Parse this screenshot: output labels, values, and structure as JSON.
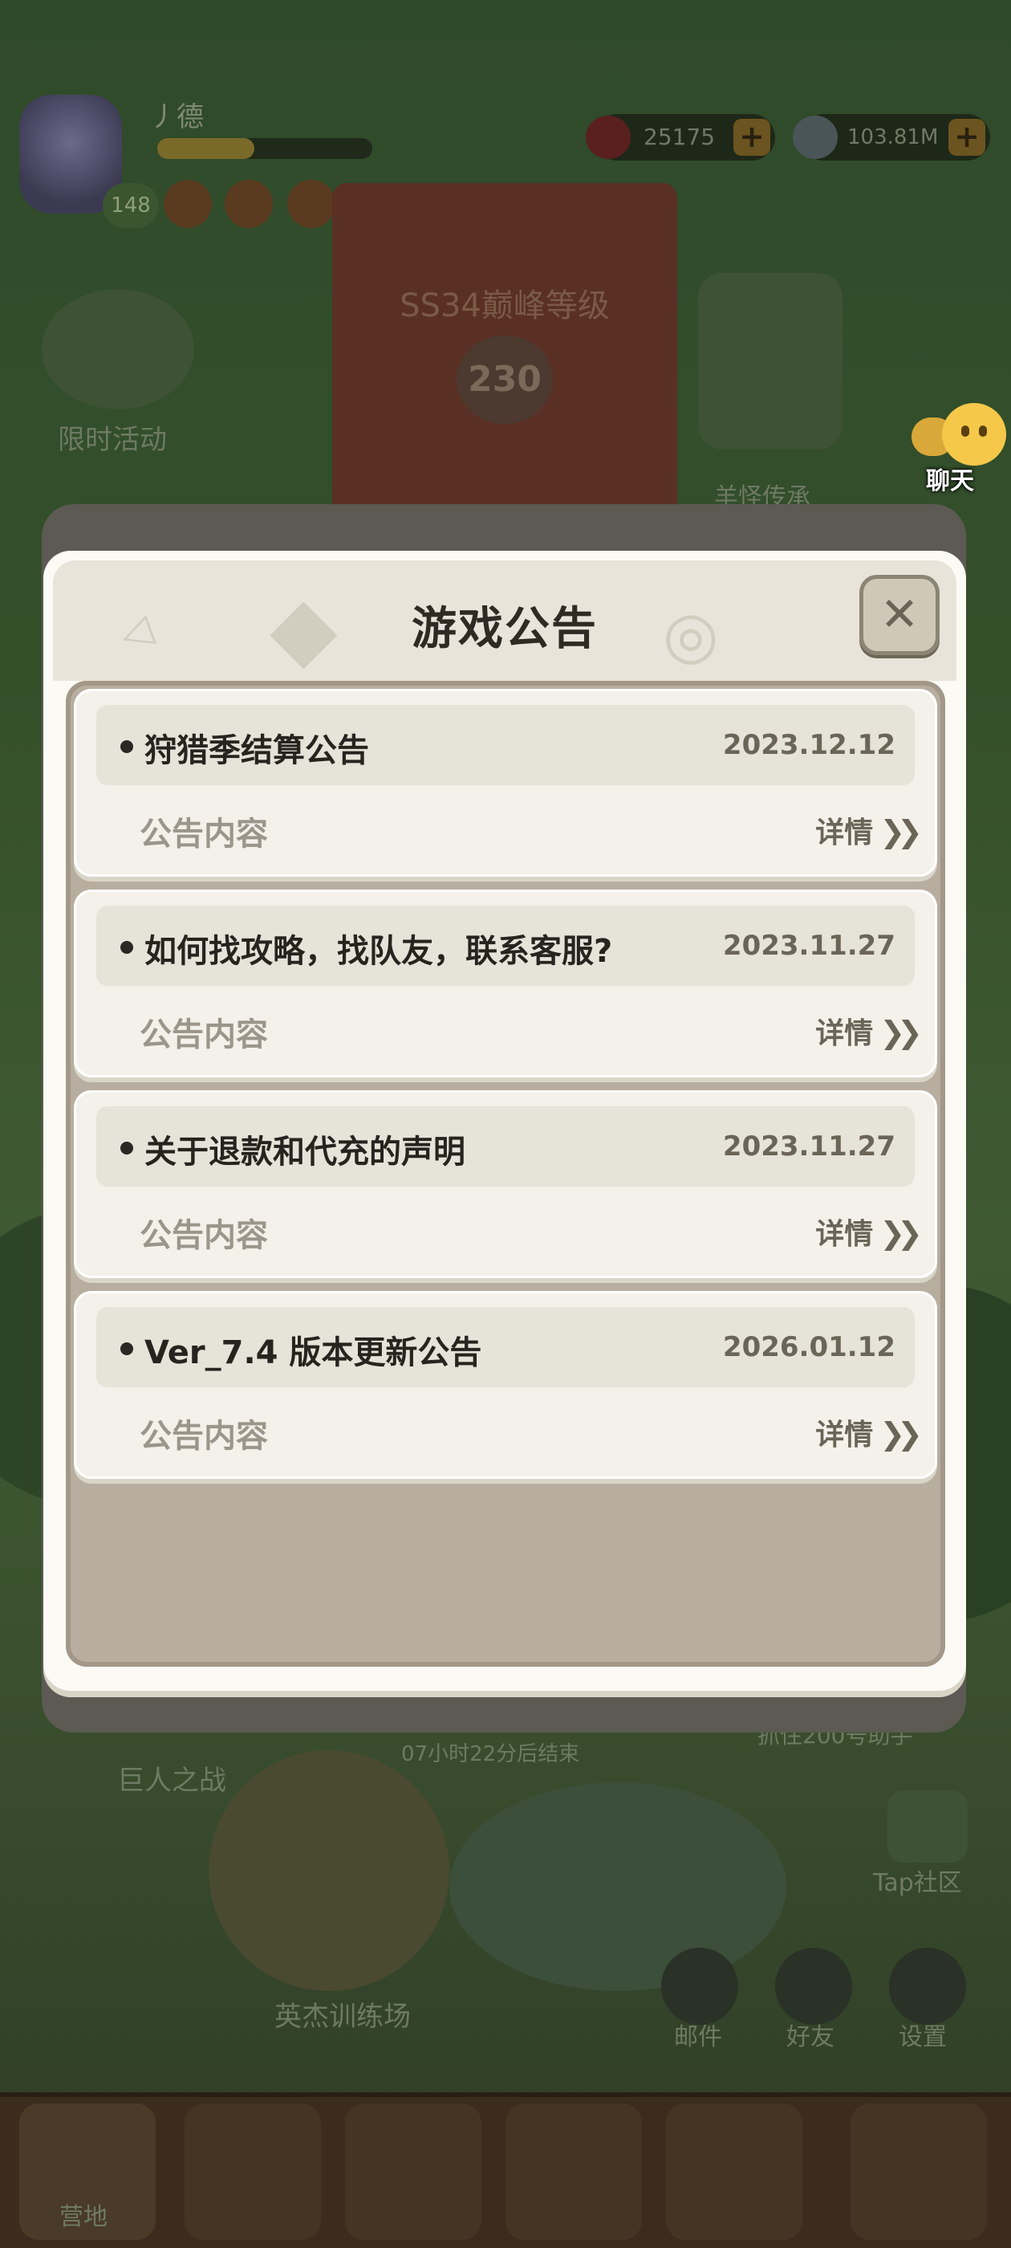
{
  "background": {
    "player_name": "丿德",
    "player_level": "148",
    "xp_progress": 0.45,
    "gems": "25175",
    "coins": "103.81M",
    "event_label": "限时活动",
    "banner_title": "SS34巅峰等级",
    "banner_level": "230",
    "right_feature_label": "羊怪传承",
    "giant_battle_label": "巨人之战",
    "timer_text": "07小时22分后结束",
    "right_promo_text": "抓住200号助手",
    "tap_label": "Tap社区",
    "training_label": "英杰训练场",
    "mail_label": "邮件",
    "friends_label": "好友",
    "settings_label": "设置",
    "camp_label": "营地"
  },
  "chat": {
    "label": "聊天"
  },
  "modal": {
    "title": "游戏公告",
    "close_symbol": "✕",
    "announcements": [
      {
        "title": "狩猎季结算公告",
        "date": "2023.12.12",
        "subtitle": "公告内容",
        "detail": "详情"
      },
      {
        "title": "如何找攻略，找队友，联系客服?",
        "date": "2023.11.27",
        "subtitle": "公告内容",
        "detail": "详情"
      },
      {
        "title": "关于退款和代充的声明",
        "date": "2023.11.27",
        "subtitle": "公告内容",
        "detail": "详情"
      },
      {
        "title": "Ver_7.4 版本更新公告",
        "date": "2026.01.12",
        "subtitle": "公告内容",
        "detail": "详情"
      }
    ]
  },
  "colors": {
    "modal_bg": "#fbfaf5",
    "panel_bg": "#b8aea0",
    "card_bg": "#f3f1e9",
    "title_text": "#2e2a24"
  }
}
